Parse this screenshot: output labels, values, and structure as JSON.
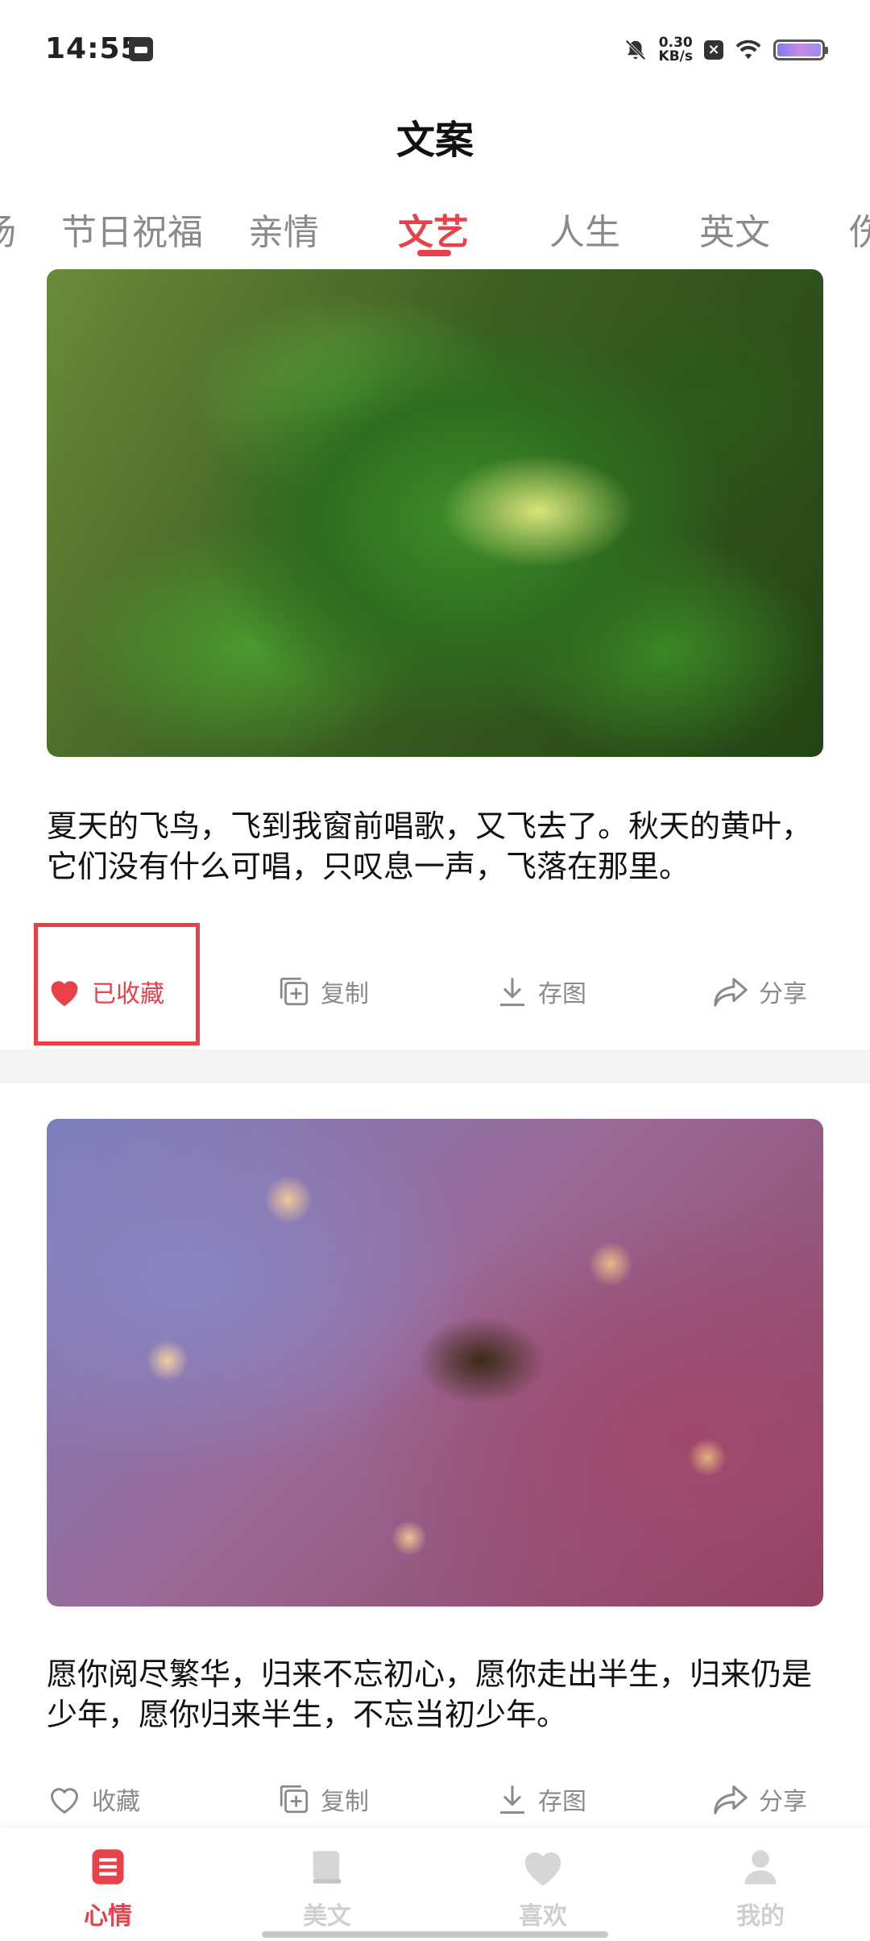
{
  "status_bar": {
    "time": "14:55",
    "net_speed_value": "0.30",
    "net_speed_unit": "KB/s"
  },
  "header": {
    "title": "文案"
  },
  "tabs": [
    {
      "label": "扬"
    },
    {
      "label": "节日祝福"
    },
    {
      "label": "亲情"
    },
    {
      "label": "文艺",
      "active": true
    },
    {
      "label": "人生"
    },
    {
      "label": "英文"
    },
    {
      "label": "伤"
    }
  ],
  "cards": [
    {
      "text": "夏天的飞鸟，飞到我窗前唱歌，又飞去了。秋天的黄叶，它们没有什么可唱，只叹息一声，飞落在那里。",
      "actions": {
        "favorite": "已收藏",
        "copy": "复制",
        "save_image": "存图",
        "share": "分享"
      },
      "favorited": true
    },
    {
      "text": "愿你阅尽繁华，归来不忘初心，愿你走出半生，归来仍是少年，愿你归来半生，不忘当初少年。",
      "actions": {
        "favorite": "收藏",
        "copy": "复制",
        "save_image": "存图",
        "share": "分享"
      },
      "favorited": false
    }
  ],
  "bottom_nav": [
    {
      "label": "心情",
      "icon": "list-icon",
      "active": true
    },
    {
      "label": "美文",
      "icon": "book-icon"
    },
    {
      "label": "喜欢",
      "icon": "heart-icon"
    },
    {
      "label": "我的",
      "icon": "person-icon"
    }
  ],
  "colors": {
    "accent": "#e8414a",
    "inactive": "#8a8a8a"
  }
}
